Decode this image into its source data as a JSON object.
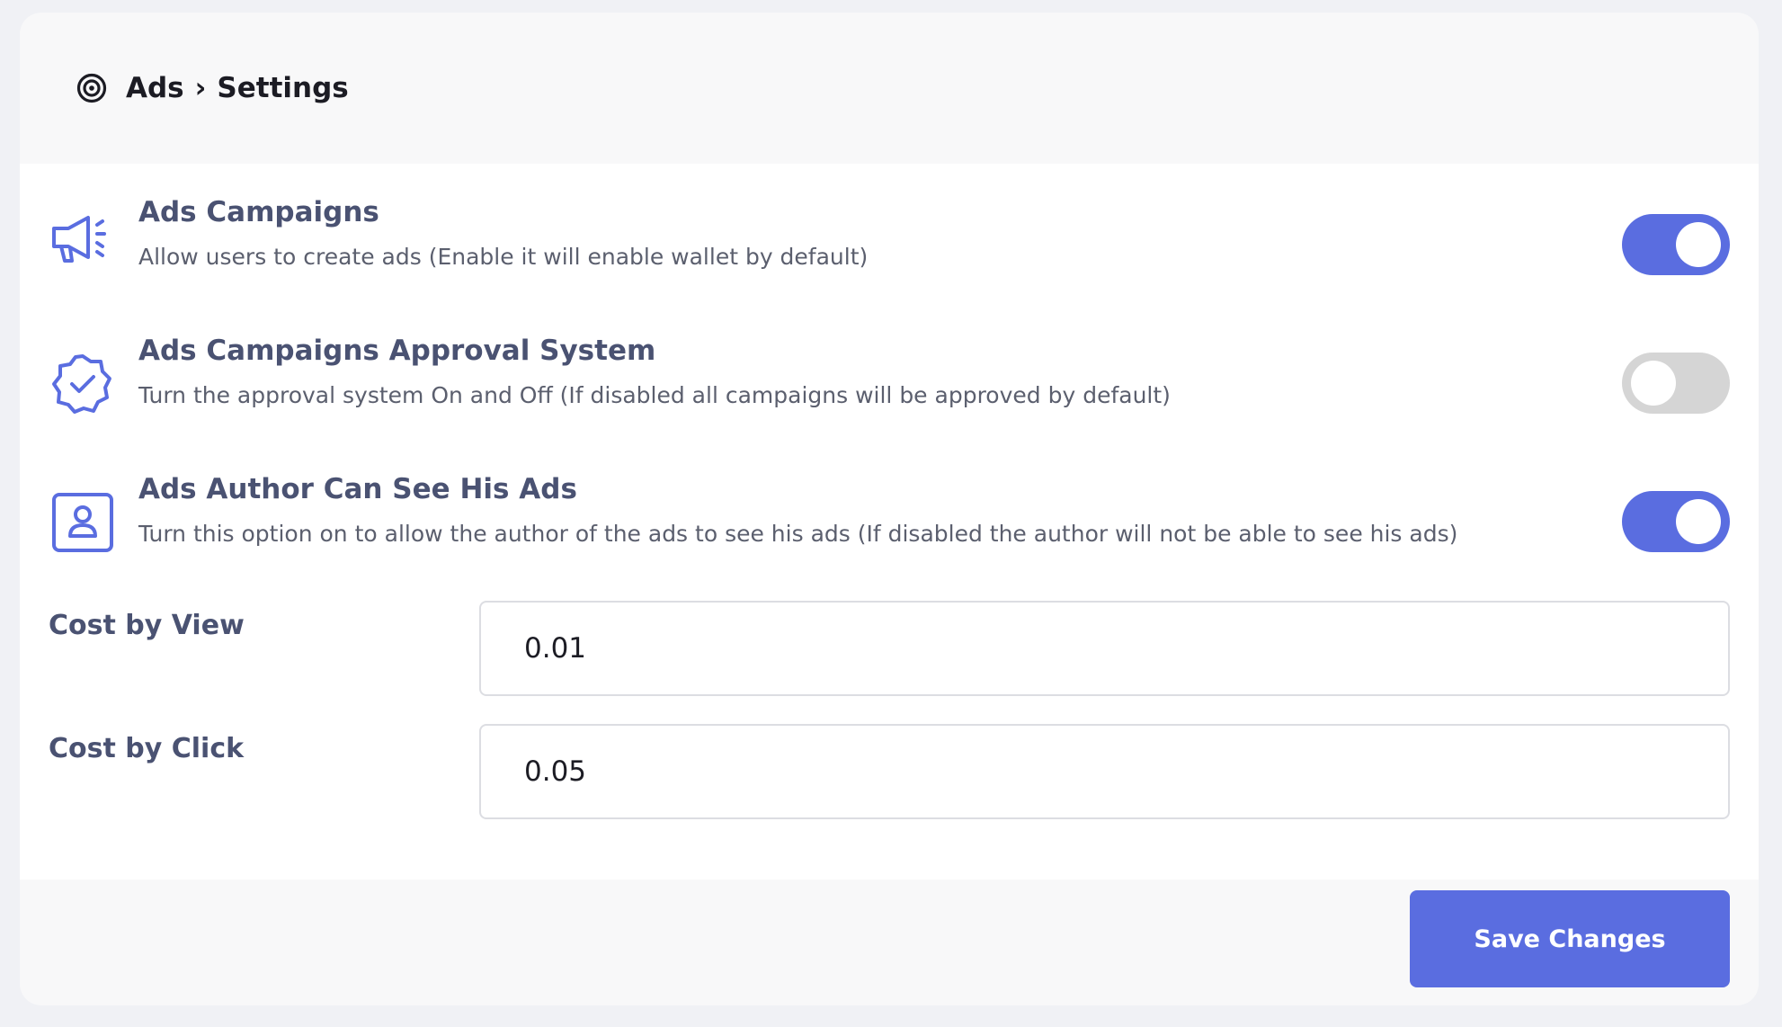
{
  "header": {
    "section": "Ads",
    "separator": "›",
    "page": "Settings",
    "icon": "target-icon"
  },
  "settings": [
    {
      "title": "Ads Campaigns",
      "description": "Allow users to create ads (Enable it will enable wallet by default)",
      "icon": "megaphone-icon",
      "enabled": true
    },
    {
      "title": "Ads Campaigns Approval System",
      "description": "Turn the approval system On and Off (If disabled all campaigns will be approved by default)",
      "icon": "badge-check-icon",
      "enabled": false
    },
    {
      "title": "Ads Author Can See His Ads",
      "description": "Turn this option on to allow the author of the ads to see his ads (If disabled the author will not be able to see his ads)",
      "icon": "user-square-icon",
      "enabled": true
    }
  ],
  "fields": {
    "cost_by_view": {
      "label": "Cost by View",
      "value": "0.01"
    },
    "cost_by_click": {
      "label": "Cost by Click",
      "value": "0.05"
    }
  },
  "footer": {
    "save_label": "Save Changes"
  },
  "colors": {
    "accent": "#5a6de0",
    "toggle_off": "#d5d5d5",
    "title_text": "#4a5272",
    "icon_color": "#5a6de0"
  }
}
